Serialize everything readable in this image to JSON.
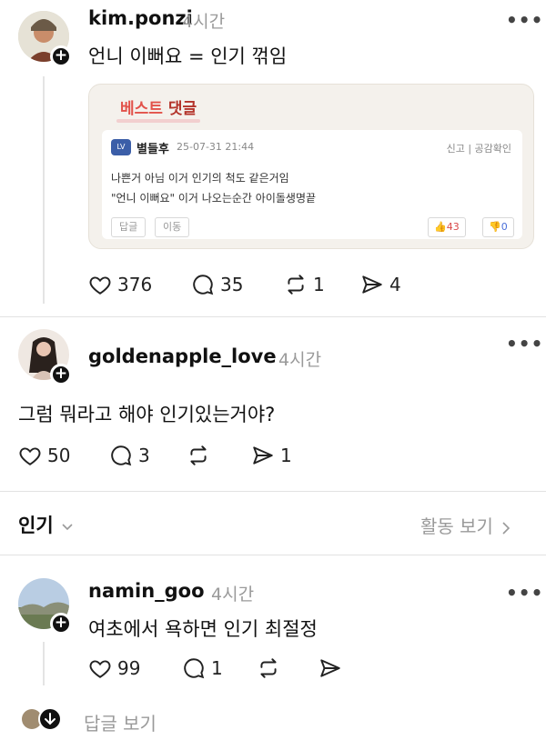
{
  "posts": [
    {
      "username": "kim.ponzi",
      "time": "4시간",
      "text": "언니 이뻐요 = 인기 꺾임",
      "likes": "376",
      "comments": "35",
      "reposts": "1",
      "shares": "4",
      "embed": {
        "title_main": "베스트",
        "title_sub": "댓글",
        "badge": "LV",
        "commenter": "별들후",
        "date": "25-07-31 21:44",
        "actions": "신고 | 공감확인",
        "line1": "나쁜거 아님 이거 인기의 척도 같은거임",
        "line2": "\"언니 이뻐요\" 이거 나오는순간 아이돌생명끝",
        "reply_btn": "답글",
        "move_btn": "이동",
        "upvotes": "43",
        "downvotes": "0"
      }
    },
    {
      "username": "goldenapple_love",
      "time": "4시간",
      "text": "그럼 뭐라고 해야 인기있는거야?",
      "likes": "50",
      "comments": "3",
      "shares": "1"
    }
  ],
  "popular": {
    "label": "인기",
    "activity": "활동 보기"
  },
  "reply": {
    "username": "namin_goo",
    "time": "4시간",
    "text": "여초에서 욕하면 인기 최절정",
    "likes": "99",
    "comments": "1"
  },
  "view_replies": "답글 보기",
  "colors": {
    "accent": "#111111",
    "muted": "#9a9a9a",
    "best_red": "#e2524a"
  },
  "icons": [
    "heart-icon",
    "comment-icon",
    "repost-icon",
    "share-icon",
    "more-icon",
    "plus-icon",
    "chevron-down-icon",
    "chevron-right-icon"
  ]
}
